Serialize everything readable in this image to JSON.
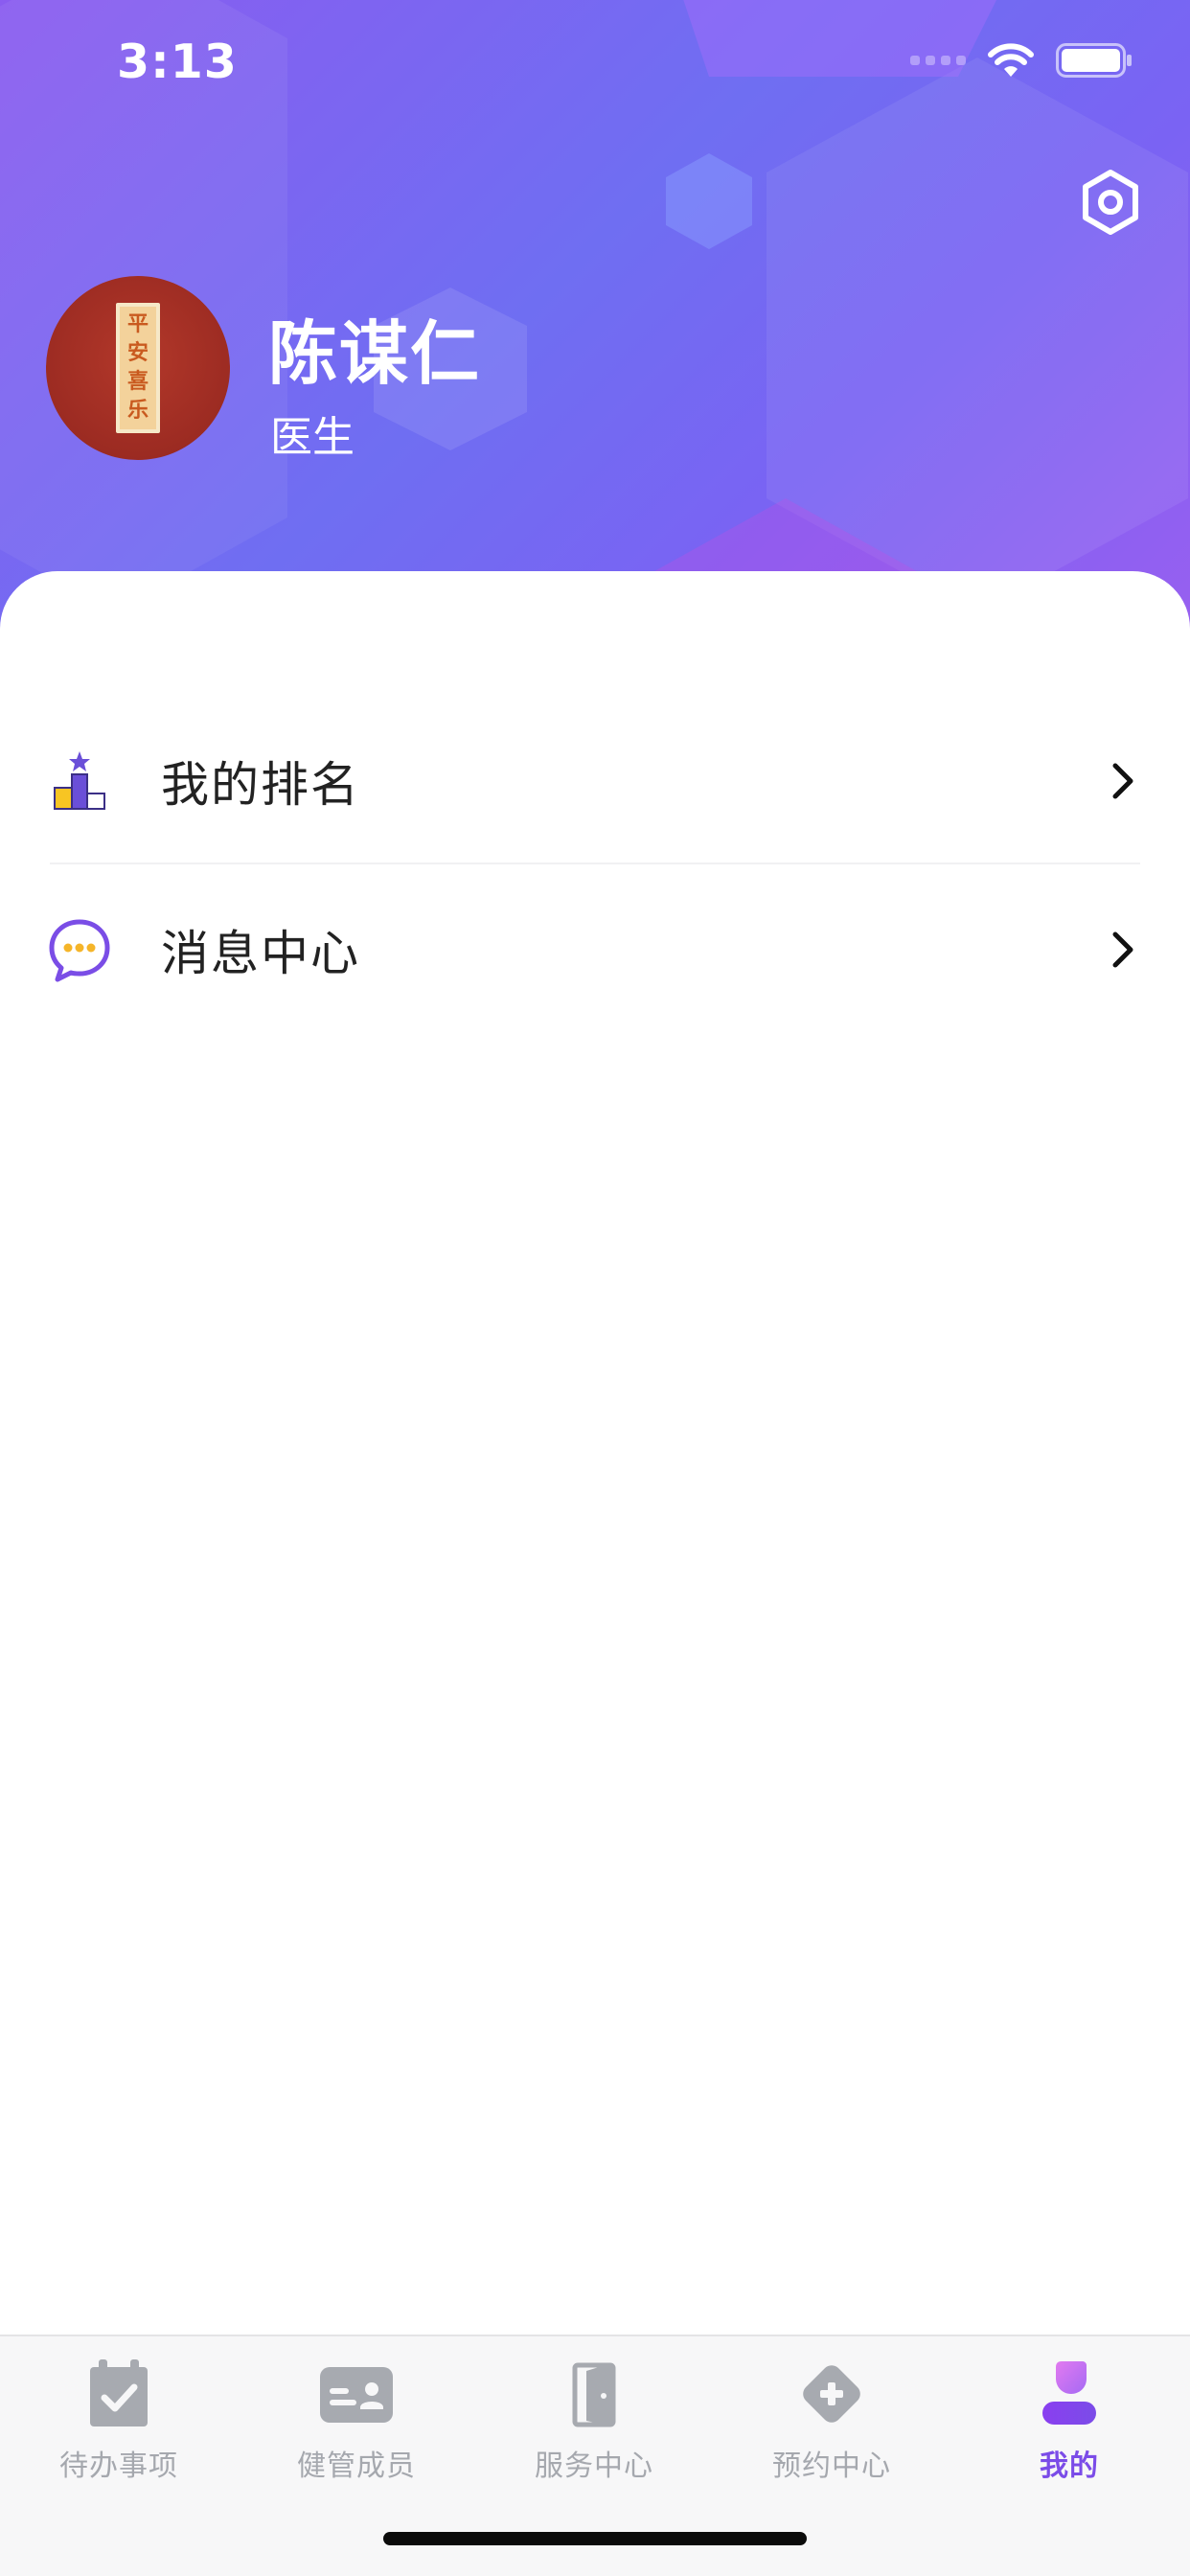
{
  "status_bar": {
    "time": "3:13",
    "icons": [
      "signal-icon",
      "wifi-icon",
      "battery-icon"
    ]
  },
  "profile": {
    "name": "陈谋仁",
    "role": "医生",
    "avatar_text": [
      "平",
      "安",
      "喜",
      "乐"
    ],
    "settings_icon": "gear-icon"
  },
  "menu": {
    "items": [
      {
        "label": "我的排名",
        "icon": "ranking-podium-icon"
      },
      {
        "label": "消息中心",
        "icon": "message-bubble-icon"
      }
    ]
  },
  "tab_bar": {
    "items": [
      {
        "label": "待办事项",
        "icon": "calendar-check-icon",
        "active": false
      },
      {
        "label": "健管成员",
        "icon": "id-card-icon",
        "active": false
      },
      {
        "label": "服务中心",
        "icon": "door-icon",
        "active": false
      },
      {
        "label": "预约中心",
        "icon": "medical-cross-icon",
        "active": false
      },
      {
        "label": "我的",
        "icon": "user-icon",
        "active": true
      }
    ]
  },
  "colors": {
    "accent": "#7b4ce8",
    "header_gradient_start": "#8a5cf0",
    "header_gradient_end": "#6f6ef2",
    "inactive_tab": "#a5a8ae",
    "text_primary": "#222222"
  }
}
